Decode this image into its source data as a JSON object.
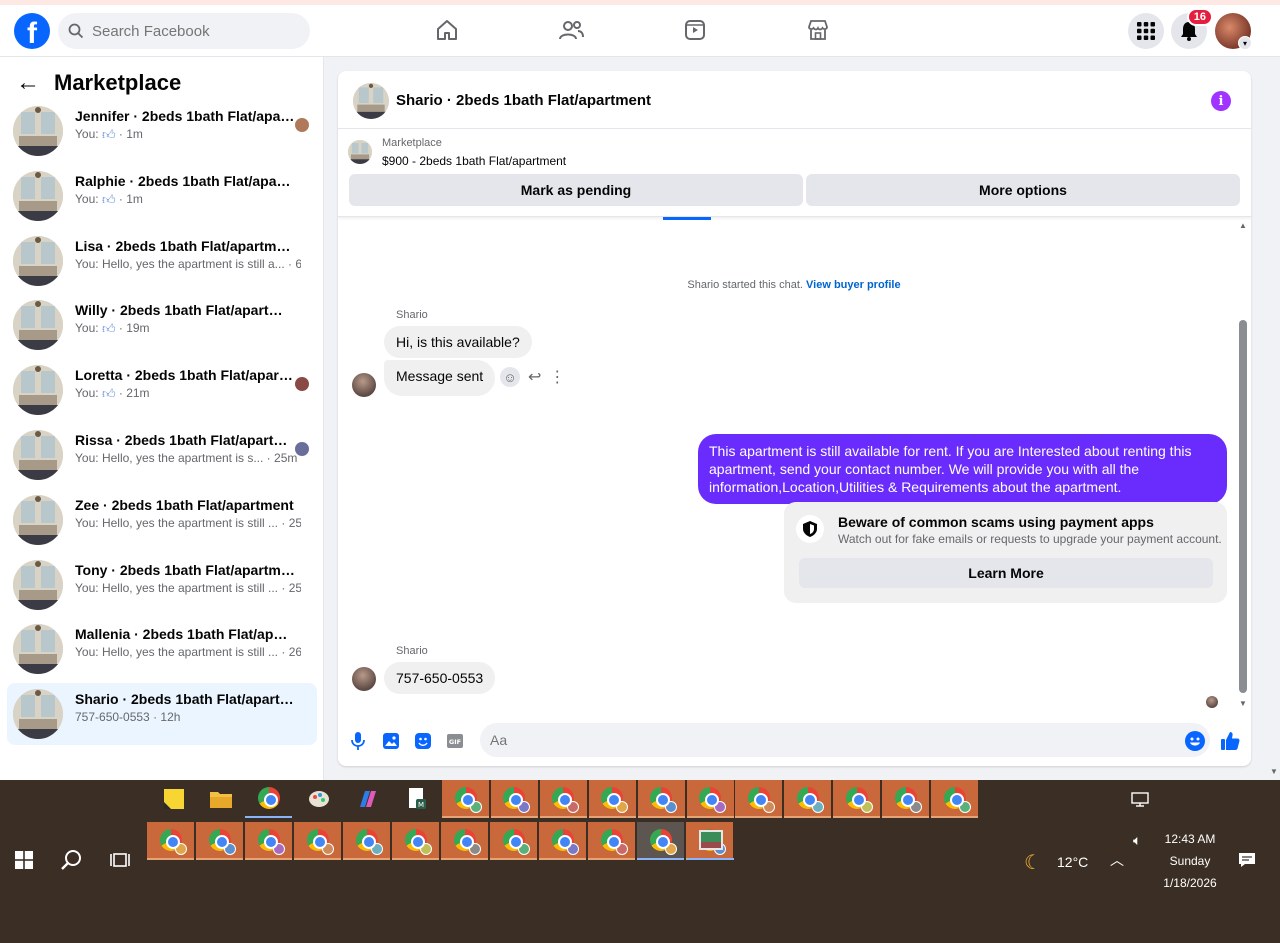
{
  "topbar": {
    "logo": "f",
    "search_placeholder": "Search Facebook",
    "notification_count": "16",
    "nav_icons": [
      "home-icon",
      "friends-icon",
      "watch-icon",
      "marketplace-icon"
    ]
  },
  "sidebar": {
    "title": "Marketplace",
    "conversations": [
      {
        "name": "Jennifer · 2beds 1bath Flat/apart...",
        "prefix": "You:",
        "preview": "",
        "like": true,
        "time": "1m",
        "seen_color": "#b07a5a",
        "active": false
      },
      {
        "name": "Ralphie · 2beds 1bath Flat/apartm...",
        "prefix": "You:",
        "preview": "",
        "like": true,
        "time": "1m",
        "seen_color": "",
        "active": false
      },
      {
        "name": "Lisa · 2beds 1bath Flat/apartment",
        "prefix": "You:",
        "preview": "Hello, yes the apartment is still a...",
        "like": false,
        "time": "6m",
        "seen_color": "",
        "active": false
      },
      {
        "name": "Willy · 2beds 1bath Flat/apartment",
        "prefix": "You:",
        "preview": "",
        "like": true,
        "time": "19m",
        "seen_color": "",
        "active": false
      },
      {
        "name": "Loretta · 2beds 1bath Flat/apart...",
        "prefix": "You:",
        "preview": "",
        "like": true,
        "time": "21m",
        "seen_color": "#8a4a44",
        "active": false
      },
      {
        "name": "Rissa · 2beds 1bath Flat/apartm...",
        "prefix": "You:",
        "preview": "Hello, yes the apartment is s...",
        "like": false,
        "time": "25m",
        "seen_color": "#6a6e9a",
        "active": false
      },
      {
        "name": "Zee · 2beds 1bath Flat/apartment",
        "prefix": "You:",
        "preview": "Hello, yes the apartment is still ...",
        "like": false,
        "time": "25m",
        "seen_color": "",
        "active": false
      },
      {
        "name": "Tony · 2beds 1bath Flat/apartment",
        "prefix": "You:",
        "preview": "Hello, yes the apartment is still ...",
        "like": false,
        "time": "25m",
        "seen_color": "",
        "active": false
      },
      {
        "name": "Mallenia · 2beds 1bath Flat/apart...",
        "prefix": "You:",
        "preview": "Hello, yes the apartment is still ...",
        "like": false,
        "time": "26m",
        "seen_color": "",
        "active": false
      },
      {
        "name": "Shario · 2beds 1bath Flat/apartment",
        "prefix": "",
        "preview": "757-650-0553",
        "like": false,
        "time": "12h",
        "seen_color": "",
        "active": true
      }
    ]
  },
  "chat": {
    "title": "Shario · 2beds 1bath Flat/apartment",
    "listing_kind": "Marketplace",
    "listing_price": "$900 - 2beds 1bath Flat/apartment",
    "mark_pending_label": "Mark as pending",
    "more_options_label": "More options",
    "started_text": "Shario started this chat.",
    "view_profile_label": "View buyer profile",
    "sender_name": "Shario",
    "incoming_1": "Hi, is this available?",
    "incoming_2": "Message sent",
    "outgoing": "This apartment is still available for rent. If you are Interested about renting this apartment, send your contact number. We will provide you with all the information,Location,Utilities & Requirements about the apartment.",
    "scam_title": "Beware of common scams using payment apps",
    "scam_text": "Watch out for fake emails or requests to upgrade your payment account.",
    "learn_more_label": "Learn More",
    "incoming_3": "757-650-0553",
    "composer_placeholder": "Aa"
  },
  "taskbar": {
    "weather_temp": "12°C",
    "time": "12:43 AM",
    "day": "Sunday",
    "date": "1/18/2026",
    "accent_color": "#c9683a"
  }
}
